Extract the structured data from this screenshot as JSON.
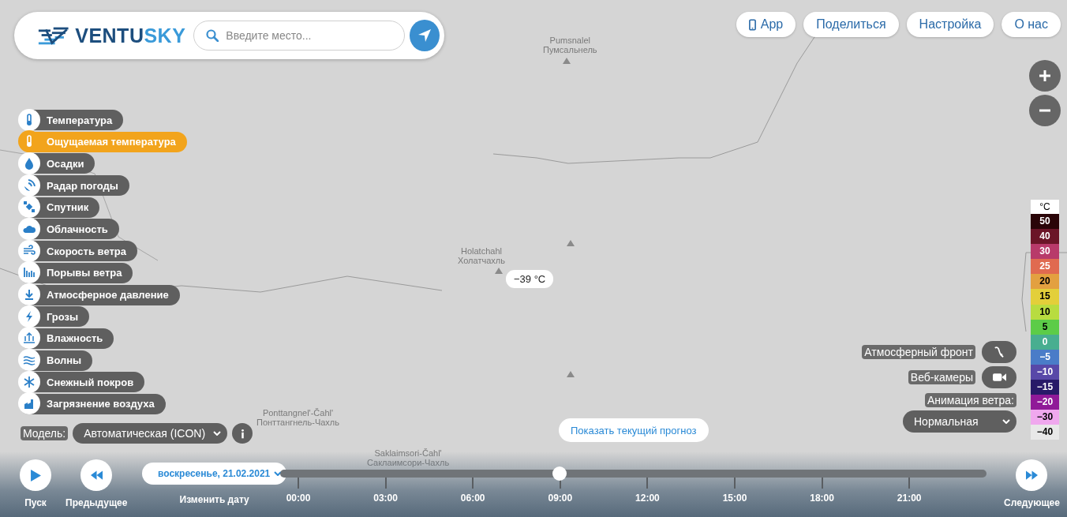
{
  "header": {
    "logo": {
      "part_1": "VENTU",
      "part_2": "SKY"
    },
    "search": {
      "placeholder": "Введите место..."
    }
  },
  "top_menu": [
    {
      "label": "App",
      "kind": "app"
    },
    {
      "label": "Поделиться",
      "kind": "plain"
    },
    {
      "label": "Настройка",
      "kind": "plain"
    },
    {
      "label": "О нас",
      "kind": "plain"
    }
  ],
  "layers": [
    {
      "label": "Температура",
      "selected": false
    },
    {
      "label": "Ощущаемая температура",
      "selected": true
    },
    {
      "label": "Осадки",
      "selected": false
    },
    {
      "label": "Радар погоды",
      "selected": false
    },
    {
      "label": "Спутник",
      "selected": false
    },
    {
      "label": "Облачность",
      "selected": false
    },
    {
      "label": "Скорость ветра",
      "selected": false
    },
    {
      "label": "Порывы ветра",
      "selected": false
    },
    {
      "label": "Атмосферное давление",
      "selected": false
    },
    {
      "label": "Грозы",
      "selected": false
    },
    {
      "label": "Влажность",
      "selected": false
    },
    {
      "label": "Волны",
      "selected": false
    },
    {
      "label": "Снежный покров",
      "selected": false
    },
    {
      "label": "Загрязнение воздуха",
      "selected": false
    }
  ],
  "model": {
    "label": "Модель:",
    "value": "Автоматическая (ICON)"
  },
  "map": {
    "labels": [
      {
        "line_1": "Pumsnalel",
        "line_2": "Пумсальнель"
      },
      {
        "line_1": "Holatchahl",
        "line_2": "Холатчахль"
      },
      {
        "line_1": "Ponttangnel'-Čahl'",
        "line_2": "Понттангнель-Чахль"
      },
      {
        "line_1": "Saklaimsori-Čahl'",
        "line_2": "Саклаимсори-Чахль"
      }
    ],
    "reading": "−39 °C",
    "current_forecast_button": "Показать текущий прогноз"
  },
  "overlays": {
    "front": {
      "label": "Атмосферный фронт",
      "on": false
    },
    "webcams": {
      "label": "Веб-камеры",
      "on": false
    },
    "wind_animation": {
      "label": "Анимация ветра:",
      "value": "Нормальная"
    }
  },
  "legend": {
    "unit": "°C",
    "items": [
      {
        "label": "50",
        "color": "#2a0508"
      },
      {
        "label": "40",
        "color": "#6b1528"
      },
      {
        "label": "30",
        "color": "#b83a6a"
      },
      {
        "label": "25",
        "color": "#e06a50"
      },
      {
        "label": "20",
        "color": "#e3a040"
      },
      {
        "label": "15",
        "color": "#e3cf3a"
      },
      {
        "label": "10",
        "color": "#b8dc40"
      },
      {
        "label": "5",
        "color": "#5ccc48"
      },
      {
        "label": "0",
        "color": "#48ae90"
      },
      {
        "label": "−5",
        "color": "#4a7cc8"
      },
      {
        "label": "−10",
        "color": "#5848a8"
      },
      {
        "label": "−15",
        "color": "#281a68"
      },
      {
        "label": "−20",
        "color": "#901a98"
      },
      {
        "label": "−30",
        "color": "#f0a8ee"
      },
      {
        "label": "−40",
        "color": "#e8e8e8"
      }
    ]
  },
  "timeline": {
    "play": "Пуск",
    "previous": "Предыдущее",
    "date": "воскресенье, 21.02.2021",
    "change_date": "Изменить дату",
    "next": "Следующее",
    "level": 0.395,
    "ticks": [
      "00:00",
      "03:00",
      "06:00",
      "09:00",
      "12:00",
      "15:00",
      "18:00",
      "21:00"
    ]
  }
}
